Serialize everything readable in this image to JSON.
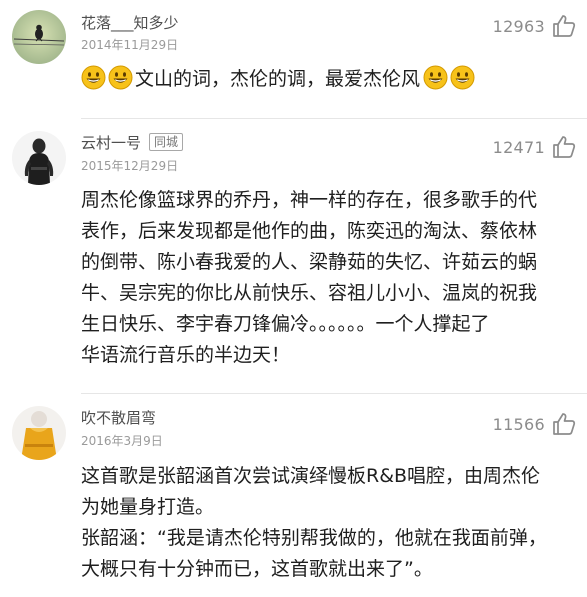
{
  "comments": [
    {
      "username": "花落___知多少",
      "date": "2014年11月29日",
      "likes": "12963",
      "badge": "",
      "text_lines": [
        "文山的词，杰伦的调，最爱杰伦风"
      ],
      "emoji": "smiling-face"
    },
    {
      "username": "云村一号",
      "date": "2015年12月29日",
      "likes": "12471",
      "badge": "同城",
      "text_lines": [
        "周杰伦像篮球界的乔丹，神一样的存在，很多歌手的代",
        "表作，后来发现都是他作的曲，陈奕迅的淘汰、蔡依林",
        "的倒带、陈小春我爱的人、梁静茹的失忆、许茹云的蜗",
        "牛、吴宗宪的你比从前快乐、容祖儿小小、温岚的祝我",
        "生日快乐、李宇春刀锋偏冷。。。。。。一个人撑起了",
        "华语流行音乐的半边天！"
      ]
    },
    {
      "username": "吹不散眉弯",
      "date": "2016年3月9日",
      "likes": "11566",
      "badge": "",
      "text_lines": [
        "这首歌是张韶涵首次尝试演绎慢板R&B唱腔，由周杰伦",
        "为她量身打造。",
        "张韶涵：“我是请杰伦特别帮我做的，他就在我面前弹，",
        "大概只有十分钟而已，这首歌就出来了”。"
      ]
    }
  ],
  "colors": {
    "username": "#4f4f4f",
    "date": "#9a9a9a",
    "likes": "#8c8c8c",
    "text": "#1f1f1f",
    "divider": "#e6e6e6",
    "emoji_yellow": "#f7c21a"
  },
  "icons": {
    "like": "thumbs-up-icon",
    "emoji": "grinning-face-icon"
  }
}
